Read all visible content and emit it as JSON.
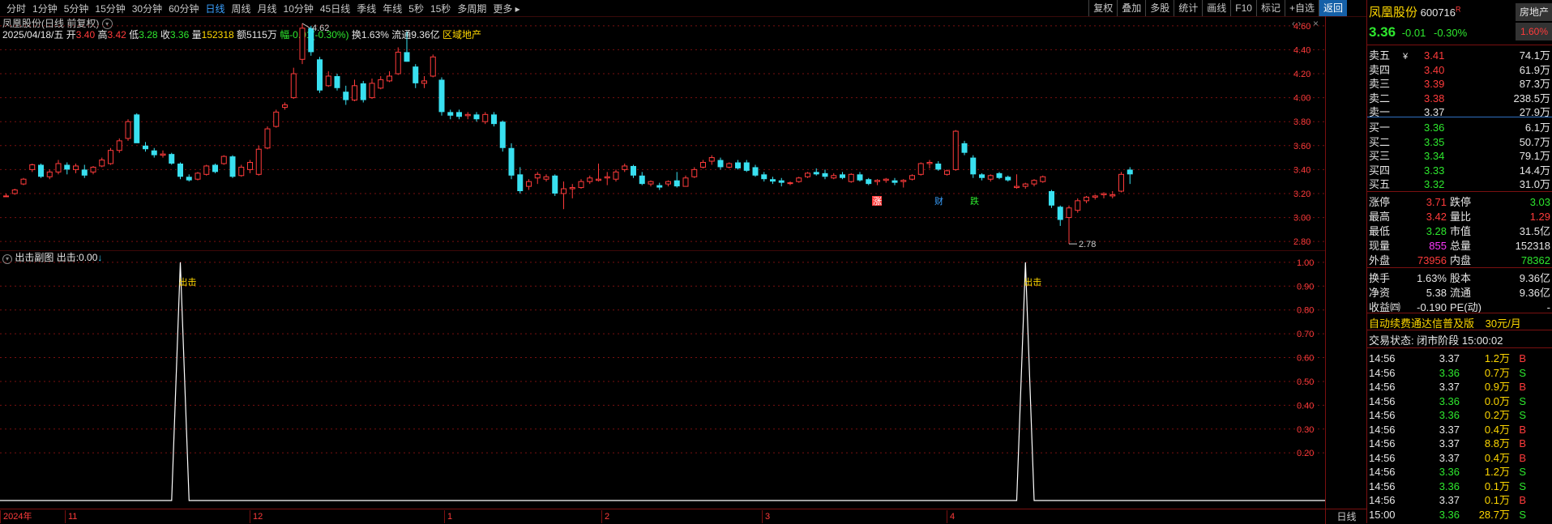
{
  "toolbar": {
    "periods": [
      "分时",
      "1分钟",
      "5分钟",
      "15分钟",
      "30分钟",
      "60分钟",
      "日线",
      "周线",
      "月线",
      "10分钟",
      "45日线",
      "季线",
      "年线",
      "5秒",
      "15秒",
      "多周期",
      "更多"
    ],
    "active_period": "日线",
    "buttons": [
      "复权",
      "叠加",
      "多股",
      "统计",
      "画线",
      "F10",
      "标记",
      "+自选",
      "返回"
    ]
  },
  "header": {
    "title": "凤凰股份(日线 前复权)",
    "date": "2025/04/18/五",
    "open_label": "开",
    "open": "3.40",
    "high_label": "高",
    "high": "3.42",
    "low_label": "低",
    "low": "3.28",
    "close_label": "收",
    "close": "3.36",
    "vol_label": "量",
    "vol": "152318",
    "amt": "额5115万",
    "chg": "幅-0.01(-0.30%)",
    "turnover": "换1.63%",
    "float_cap": "流通9.36亿",
    "sector": "区域地产"
  },
  "indicator": {
    "title": "出击副图",
    "value_label": "出击:",
    "value": "0.00"
  },
  "annotations": {
    "high_mark": "4.62",
    "low_mark": "2.78",
    "signal_label": "出击",
    "event_up": "涨",
    "event_fin": "财",
    "event_down": "跌",
    "panel_mode": "日线"
  },
  "chart_data": [
    {
      "type": "candlestick",
      "y_ticks": [
        "4.60",
        "4.40",
        "4.20",
        "4.00",
        "3.80",
        "3.60",
        "3.40",
        "3.20",
        "3.00",
        "2.80"
      ],
      "ylim": [
        2.72,
        4.68
      ],
      "x_ticks": [
        "2024年",
        "11",
        "12",
        "1",
        "2",
        "3",
        "4"
      ],
      "ohlc": [
        [
          3.18,
          3.2,
          3.17,
          3.18
        ],
        [
          3.2,
          3.24,
          3.19,
          3.23
        ],
        [
          3.28,
          3.33,
          3.27,
          3.32
        ],
        [
          3.4,
          3.45,
          3.38,
          3.44
        ],
        [
          3.44,
          3.45,
          3.33,
          3.34
        ],
        [
          3.34,
          3.4,
          3.32,
          3.38
        ],
        [
          3.38,
          3.48,
          3.36,
          3.45
        ],
        [
          3.44,
          3.46,
          3.36,
          3.4
        ],
        [
          3.4,
          3.45,
          3.37,
          3.43
        ],
        [
          3.4,
          3.44,
          3.33,
          3.35
        ],
        [
          3.38,
          3.43,
          3.36,
          3.42
        ],
        [
          3.43,
          3.5,
          3.42,
          3.48
        ],
        [
          3.45,
          3.58,
          3.44,
          3.56
        ],
        [
          3.56,
          3.66,
          3.54,
          3.64
        ],
        [
          3.66,
          3.82,
          3.64,
          3.8
        ],
        [
          3.86,
          3.87,
          3.64,
          3.62
        ],
        [
          3.6,
          3.63,
          3.55,
          3.57
        ],
        [
          3.56,
          3.58,
          3.5,
          3.52
        ],
        [
          3.52,
          3.56,
          3.5,
          3.53
        ],
        [
          3.53,
          3.54,
          3.44,
          3.45
        ],
        [
          3.45,
          3.46,
          3.32,
          3.34
        ],
        [
          3.34,
          3.36,
          3.3,
          3.31
        ],
        [
          3.32,
          3.38,
          3.31,
          3.37
        ],
        [
          3.36,
          3.44,
          3.35,
          3.43
        ],
        [
          3.44,
          3.45,
          3.37,
          3.38
        ],
        [
          3.45,
          3.52,
          3.44,
          3.51
        ],
        [
          3.51,
          3.52,
          3.33,
          3.34
        ],
        [
          3.35,
          3.44,
          3.34,
          3.42
        ],
        [
          3.4,
          3.48,
          3.37,
          3.46
        ],
        [
          3.36,
          3.6,
          3.35,
          3.57
        ],
        [
          3.58,
          3.76,
          3.57,
          3.74
        ],
        [
          3.76,
          3.9,
          3.75,
          3.88
        ],
        [
          3.92,
          3.96,
          3.9,
          3.94
        ],
        [
          4.0,
          4.25,
          3.99,
          4.2
        ],
        [
          4.32,
          4.62,
          4.28,
          4.58
        ],
        [
          4.58,
          4.6,
          4.35,
          4.38
        ],
        [
          4.32,
          4.34,
          4.04,
          4.06
        ],
        [
          4.1,
          4.22,
          4.09,
          4.18
        ],
        [
          4.18,
          4.2,
          4.06,
          4.08
        ],
        [
          4.05,
          4.1,
          3.94,
          3.98
        ],
        [
          3.98,
          4.15,
          3.97,
          4.1
        ],
        [
          4.12,
          4.14,
          3.96,
          3.98
        ],
        [
          4.0,
          4.16,
          3.99,
          4.12
        ],
        [
          4.08,
          4.18,
          4.07,
          4.15
        ],
        [
          4.14,
          4.22,
          4.13,
          4.18
        ],
        [
          4.2,
          4.42,
          4.19,
          4.38
        ],
        [
          4.38,
          4.55,
          4.3,
          4.3
        ],
        [
          4.26,
          4.28,
          4.08,
          4.12
        ],
        [
          4.12,
          4.18,
          4.08,
          4.14
        ],
        [
          4.18,
          4.36,
          4.17,
          4.34
        ],
        [
          4.15,
          4.17,
          3.85,
          3.88
        ],
        [
          3.88,
          3.9,
          3.82,
          3.85
        ],
        [
          3.88,
          3.9,
          3.82,
          3.84
        ],
        [
          3.85,
          3.88,
          3.82,
          3.86
        ],
        [
          3.86,
          3.88,
          3.8,
          3.82
        ],
        [
          3.8,
          3.88,
          3.78,
          3.86
        ],
        [
          3.86,
          3.88,
          3.76,
          3.78
        ],
        [
          3.8,
          3.81,
          3.55,
          3.58
        ],
        [
          3.58,
          3.62,
          3.32,
          3.35
        ],
        [
          3.36,
          3.42,
          3.2,
          3.22
        ],
        [
          3.26,
          3.32,
          3.23,
          3.3
        ],
        [
          3.33,
          3.38,
          3.28,
          3.36
        ],
        [
          3.32,
          3.36,
          3.3,
          3.34
        ],
        [
          3.35,
          3.36,
          3.18,
          3.2
        ],
        [
          3.2,
          3.3,
          3.07,
          3.24
        ],
        [
          3.24,
          3.28,
          3.16,
          3.25
        ],
        [
          3.25,
          3.32,
          3.24,
          3.3
        ],
        [
          3.3,
          3.35,
          3.28,
          3.33
        ],
        [
          3.31,
          3.45,
          3.3,
          3.32
        ],
        [
          3.33,
          3.38,
          3.27,
          3.34
        ],
        [
          3.32,
          3.4,
          3.3,
          3.38
        ],
        [
          3.4,
          3.45,
          3.38,
          3.43
        ],
        [
          3.43,
          3.44,
          3.33,
          3.35
        ],
        [
          3.35,
          3.38,
          3.27,
          3.28
        ],
        [
          3.28,
          3.31,
          3.26,
          3.3
        ],
        [
          3.27,
          3.29,
          3.23,
          3.25
        ],
        [
          3.28,
          3.31,
          3.26,
          3.3
        ],
        [
          3.31,
          3.38,
          3.25,
          3.26
        ],
        [
          3.26,
          3.35,
          3.26,
          3.33
        ],
        [
          3.34,
          3.42,
          3.33,
          3.4
        ],
        [
          3.42,
          3.48,
          3.41,
          3.46
        ],
        [
          3.47,
          3.52,
          3.44,
          3.5
        ],
        [
          3.48,
          3.5,
          3.4,
          3.42
        ],
        [
          3.42,
          3.46,
          3.41,
          3.45
        ],
        [
          3.46,
          3.48,
          3.4,
          3.41
        ],
        [
          3.46,
          3.48,
          3.38,
          3.39
        ],
        [
          3.42,
          3.44,
          3.34,
          3.35
        ],
        [
          3.36,
          3.38,
          3.3,
          3.32
        ],
        [
          3.32,
          3.34,
          3.28,
          3.3
        ],
        [
          3.31,
          3.33,
          3.26,
          3.29
        ],
        [
          3.29,
          3.3,
          3.27,
          3.29
        ],
        [
          3.3,
          3.34,
          3.29,
          3.33
        ],
        [
          3.34,
          3.38,
          3.33,
          3.37
        ],
        [
          3.38,
          3.41,
          3.35,
          3.36
        ],
        [
          3.37,
          3.4,
          3.32,
          3.34
        ],
        [
          3.33,
          3.37,
          3.32,
          3.35
        ],
        [
          3.36,
          3.38,
          3.32,
          3.33
        ],
        [
          3.3,
          3.37,
          3.29,
          3.36
        ],
        [
          3.36,
          3.38,
          3.3,
          3.31
        ],
        [
          3.32,
          3.33,
          3.27,
          3.28
        ],
        [
          3.3,
          3.32,
          3.27,
          3.31
        ],
        [
          3.31,
          3.33,
          3.29,
          3.32
        ],
        [
          3.31,
          3.33,
          3.27,
          3.29
        ],
        [
          3.3,
          3.32,
          3.25,
          3.31
        ],
        [
          3.32,
          3.36,
          3.31,
          3.35
        ],
        [
          3.36,
          3.46,
          3.35,
          3.45
        ],
        [
          3.45,
          3.48,
          3.41,
          3.46
        ],
        [
          3.45,
          3.47,
          3.39,
          3.4
        ],
        [
          3.36,
          3.4,
          3.35,
          3.39
        ],
        [
          3.4,
          3.73,
          3.39,
          3.72
        ],
        [
          3.62,
          3.64,
          3.52,
          3.54
        ],
        [
          3.5,
          3.52,
          3.33,
          3.36
        ],
        [
          3.36,
          3.37,
          3.31,
          3.33
        ],
        [
          3.32,
          3.36,
          3.3,
          3.35
        ],
        [
          3.37,
          3.38,
          3.32,
          3.33
        ],
        [
          3.34,
          3.35,
          3.3,
          3.31
        ],
        [
          3.25,
          3.36,
          3.24,
          3.26
        ],
        [
          3.26,
          3.29,
          3.24,
          3.28
        ],
        [
          3.28,
          3.32,
          3.26,
          3.31
        ],
        [
          3.3,
          3.35,
          3.29,
          3.34
        ],
        [
          3.22,
          3.23,
          3.08,
          3.1
        ],
        [
          3.09,
          3.1,
          2.93,
          2.98
        ],
        [
          3.0,
          3.1,
          2.78,
          3.08
        ],
        [
          3.06,
          3.16,
          3.04,
          3.14
        ],
        [
          3.14,
          3.18,
          3.12,
          3.17
        ],
        [
          3.17,
          3.19,
          3.15,
          3.18
        ],
        [
          3.19,
          3.21,
          3.16,
          3.2
        ],
        [
          3.18,
          3.22,
          3.16,
          3.19
        ],
        [
          3.22,
          3.38,
          3.21,
          3.36
        ],
        [
          3.4,
          3.42,
          3.28,
          3.36
        ]
      ]
    },
    {
      "type": "line",
      "name": "出击",
      "y_ticks": [
        "1.00",
        "0.90",
        "0.80",
        "0.70",
        "0.60",
        "0.50",
        "0.40",
        "0.30",
        "0.20"
      ],
      "ylim": [
        0,
        1.02
      ],
      "points": [
        [
          0,
          0
        ],
        [
          19,
          0
        ],
        [
          20,
          1
        ],
        [
          21,
          0
        ],
        [
          116,
          0
        ],
        [
          117,
          1
        ],
        [
          118,
          0
        ],
        [
          120,
          0
        ]
      ]
    }
  ],
  "panel": {
    "stock_name": "凤凰股份",
    "code": "600716",
    "r_mark": "R",
    "sector_tag": "房地产",
    "price": "3.36",
    "change": "-0.01",
    "change_pct": "-0.30%",
    "pct_box": "1.60%",
    "asks": [
      {
        "label": "卖五",
        "flag": "¥",
        "price": "3.41",
        "vol": "74.1万"
      },
      {
        "label": "卖四",
        "flag": "",
        "price": "3.40",
        "vol": "61.9万"
      },
      {
        "label": "卖三",
        "flag": "",
        "price": "3.39",
        "vol": "87.3万"
      },
      {
        "label": "卖二",
        "flag": "",
        "price": "3.38",
        "vol": "238.5万"
      },
      {
        "label": "卖一",
        "flag": "",
        "price": "3.37",
        "vol": "27.9万"
      }
    ],
    "bids": [
      {
        "label": "买一",
        "price": "3.36",
        "vol": "6.1万"
      },
      {
        "label": "买二",
        "price": "3.35",
        "vol": "50.7万"
      },
      {
        "label": "买三",
        "price": "3.34",
        "vol": "79.1万"
      },
      {
        "label": "买四",
        "price": "3.33",
        "vol": "14.4万"
      },
      {
        "label": "买五",
        "price": "3.32",
        "vol": "31.0万"
      }
    ],
    "stats": [
      {
        "l1": "涨停",
        "v1": "3.71",
        "l2": "跌停",
        "v2": "3.03"
      },
      {
        "l1": "最高",
        "v1": "3.42",
        "l2": "量比",
        "v2": "1.29"
      },
      {
        "l1": "最低",
        "v1": "3.28",
        "l2": "市值",
        "v2": "31.5亿"
      },
      {
        "l1": "现量",
        "v1": "855",
        "l2": "总量",
        "v2": "152318"
      },
      {
        "l1": "外盘",
        "v1": "73956",
        "l2": "内盘",
        "v2": "78362"
      }
    ],
    "fund": [
      {
        "l1": "换手",
        "v1": "1.63%",
        "l2": "股本",
        "v2": "9.36亿"
      },
      {
        "l1": "净资",
        "v1": "5.38",
        "l2": "流通",
        "v2": "9.36亿"
      },
      {
        "l1": "收益㈣",
        "v1": "-0.190",
        "l2": "PE(动)",
        "v2": "-"
      }
    ],
    "promo": "自动续费通达信普及版",
    "promo_price": "30元/月",
    "trade_status": "交易状态: 闭市阶段 15:00:02",
    "ticks": [
      {
        "t": "14:56",
        "p": "3.37",
        "v": "1.2万",
        "d": "B"
      },
      {
        "t": "14:56",
        "p": "3.36",
        "v": "0.7万",
        "d": "S"
      },
      {
        "t": "14:56",
        "p": "3.37",
        "v": "0.9万",
        "d": "B"
      },
      {
        "t": "14:56",
        "p": "3.36",
        "v": "0.0万",
        "d": "S"
      },
      {
        "t": "14:56",
        "p": "3.36",
        "v": "0.2万",
        "d": "S"
      },
      {
        "t": "14:56",
        "p": "3.37",
        "v": "0.4万",
        "d": "B"
      },
      {
        "t": "14:56",
        "p": "3.37",
        "v": "8.8万",
        "d": "B"
      },
      {
        "t": "14:56",
        "p": "3.37",
        "v": "0.4万",
        "d": "B"
      },
      {
        "t": "14:56",
        "p": "3.36",
        "v": "1.2万",
        "d": "S"
      },
      {
        "t": "14:56",
        "p": "3.36",
        "v": "0.1万",
        "d": "S"
      },
      {
        "t": "14:56",
        "p": "3.37",
        "v": "0.1万",
        "d": "B"
      },
      {
        "t": "15:00",
        "p": "3.36",
        "v": "28.7万",
        "d": "S"
      }
    ]
  },
  "colors": {
    "up": "#ff3b3b",
    "down": "#39e0f0",
    "grid": "#7a1010",
    "signal": "#ffffff",
    "label_yellow": "#ffd800"
  }
}
